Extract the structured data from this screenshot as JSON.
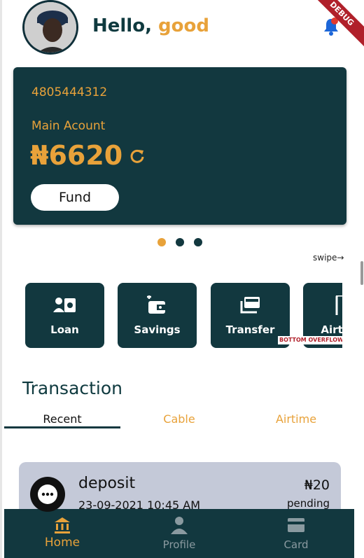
{
  "header": {
    "greeting": "Hello,",
    "user_name": "good"
  },
  "debug_banner": "DEBUG",
  "account_card": {
    "account_number": "4805444312",
    "account_label": "Main Acount",
    "balance": "₦6620",
    "fund_label": "Fund"
  },
  "swipe_hint": "swipe→",
  "carousel": {
    "pages": 3,
    "active_page": 1
  },
  "actions": [
    {
      "label": "Loan"
    },
    {
      "label": "Savings"
    },
    {
      "label": "Transfer"
    },
    {
      "label": "Airtime"
    }
  ],
  "overflow_warning": "BOTTOM OVERFLOWED",
  "transactions": {
    "title": "Transaction",
    "tabs": [
      {
        "label": "Recent"
      },
      {
        "label": "Cable"
      },
      {
        "label": "Airtime"
      }
    ],
    "items": [
      {
        "type": "deposit",
        "date": "23-09-2021 10:45 AM",
        "amount": "₦20",
        "status": "pending"
      }
    ]
  },
  "bottom_nav": [
    {
      "label": "Home"
    },
    {
      "label": "Profile"
    },
    {
      "label": "Card"
    }
  ],
  "colors": {
    "primary": "#12383f",
    "accent": "#e8a23a",
    "notification_dot": "#e23a2f",
    "transaction_card": "#c4c9d8"
  }
}
